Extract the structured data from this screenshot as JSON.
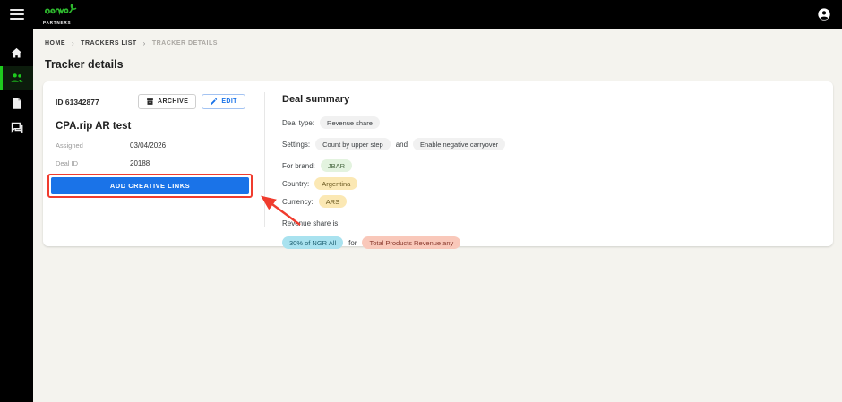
{
  "colors": {
    "accent_green": "#1ecb1e",
    "button_blue": "#1a73e8",
    "annotation_red": "#f03c2e",
    "chip_gray_bg": "#f1f1f1",
    "chip_green_bg": "#e3f3df",
    "chip_yellow_bg": "#fbe8b4",
    "chip_cyan_bg": "#a9e2ef",
    "chip_salmon_bg": "#f9c8ba"
  },
  "header": {
    "logo_sub": "PARTNERS",
    "icons": {
      "menu": "hamburger-icon",
      "account": "account-circle-icon",
      "logo": "growe-logo-scribble"
    }
  },
  "sidebar": {
    "items": [
      {
        "icon": "home-icon",
        "active": false
      },
      {
        "icon": "people-icon",
        "active": true
      },
      {
        "icon": "document-icon",
        "active": false
      },
      {
        "icon": "chat-icon",
        "active": false
      }
    ]
  },
  "breadcrumb": {
    "items": [
      "HOME",
      "TRACKERS LIST",
      "TRACKER DETAILS"
    ],
    "separator": "›"
  },
  "page": {
    "title": "Tracker details"
  },
  "tracker": {
    "id_text": "ID 61342877",
    "archive_label": "ARCHIVE",
    "edit_label": "EDIT",
    "name": "CPA.rip AR test",
    "fields": [
      {
        "label": "Assigned",
        "value": "03/04/2026"
      },
      {
        "label": "Deal ID",
        "value": "20188"
      }
    ],
    "add_links_label": "ADD CREATIVE LINKS"
  },
  "deal_summary": {
    "title": "Deal summary",
    "deal_type_label": "Deal type:",
    "deal_type_chip": "Revenue share",
    "settings_label": "Settings:",
    "settings_chip_1": "Count by upper step",
    "settings_conjunction": "and",
    "settings_chip_2": "Enable negative carryover",
    "brand_label": "For brand:",
    "brand_chip": "JBAR",
    "country_label": "Country:",
    "country_chip": "Argentina",
    "currency_label": "Currency:",
    "currency_chip": "ARS",
    "revenue_label": "Revenue share is:",
    "revenue_chip_1": "30% of NGR All",
    "revenue_conjunction": "for",
    "revenue_chip_2": "Total Products Revenue any"
  },
  "annotation": {
    "type": "highlight-box-and-arrow",
    "color": "#f03c2e"
  }
}
